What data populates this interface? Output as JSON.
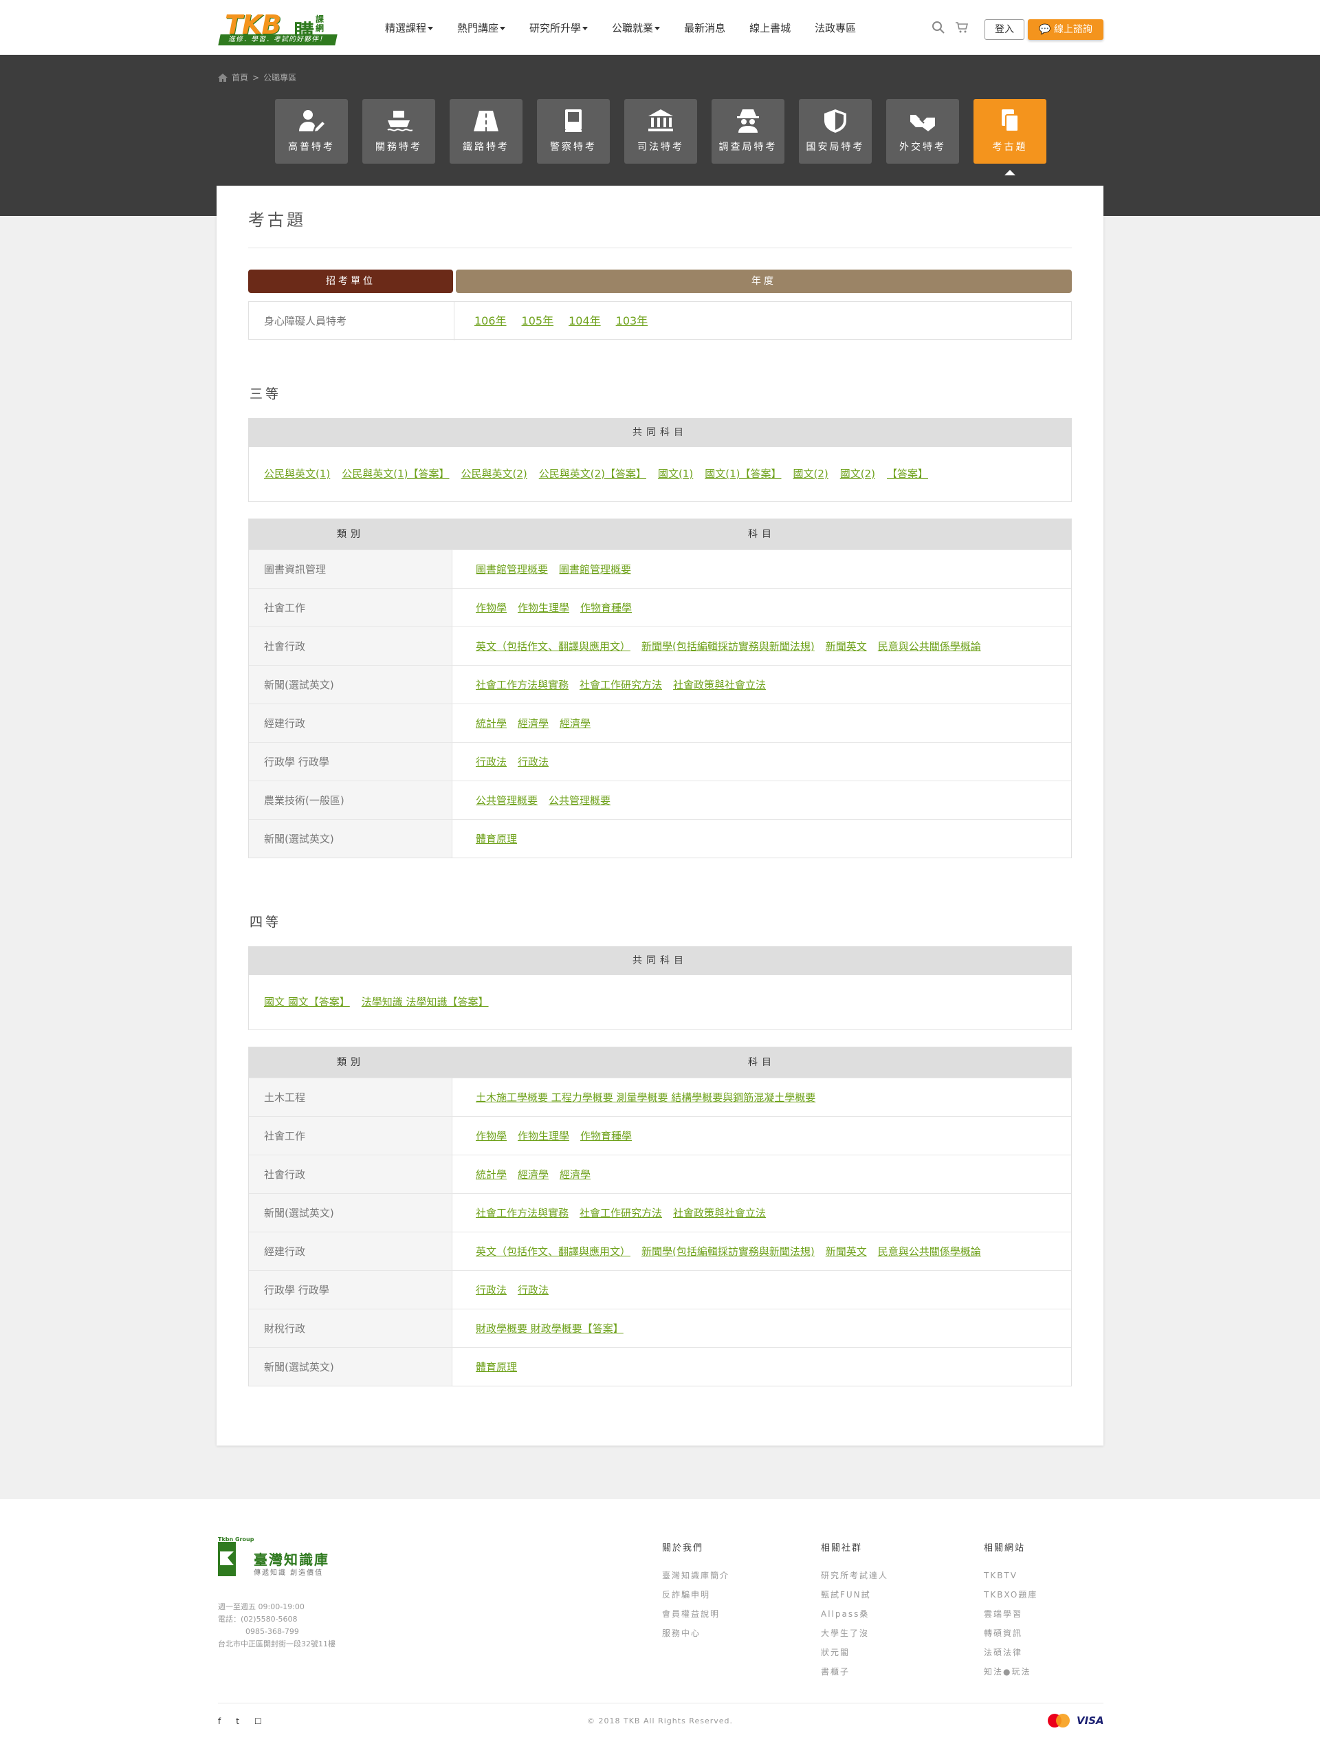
{
  "header": {
    "logo_text": "TKB",
    "logo_gou": "購",
    "logo_small": "課網",
    "logo_slogan": "進修．學習．考試的好夥伴！",
    "nav": [
      {
        "label": "精選課程",
        "dropdown": true
      },
      {
        "label": "熱門講座",
        "dropdown": true
      },
      {
        "label": "研究所升學",
        "dropdown": true
      },
      {
        "label": "公職就業",
        "dropdown": true
      },
      {
        "label": "最新消息",
        "dropdown": false
      },
      {
        "label": "線上書城",
        "dropdown": false
      },
      {
        "label": "法政專區",
        "dropdown": false
      }
    ],
    "login_label": "登入",
    "consult_label": "線上諮詢",
    "accent": "#f4941d"
  },
  "breadcrumb": {
    "home": "首頁",
    "sep": ">",
    "current": "公職專區"
  },
  "categories": [
    {
      "label": "高普特考",
      "icon": "user-edit-icon"
    },
    {
      "label": "關務特考",
      "icon": "ship-icon"
    },
    {
      "label": "鐵路特考",
      "icon": "road-icon"
    },
    {
      "label": "警察特考",
      "icon": "book-icon"
    },
    {
      "label": "司法特考",
      "icon": "courthouse-icon"
    },
    {
      "label": "調查局特考",
      "icon": "detective-icon"
    },
    {
      "label": "國安局特考",
      "icon": "shield-icon"
    },
    {
      "label": "外交特考",
      "icon": "handshake-icon"
    },
    {
      "label": "考古題",
      "icon": "copy-icon",
      "active": true
    }
  ],
  "main": {
    "title": "考古題",
    "unit_header": "招考單位",
    "year_header": "年度",
    "unit_header_color": "#6b2a18",
    "year_header_color": "#9b8466",
    "unit": "身心障礙人員特考",
    "years": [
      "106年",
      "105年",
      "104年",
      "103年"
    ]
  },
  "level3": {
    "title": "三等",
    "common_header": "共同科目",
    "common_links": [
      "公民與英文(1)",
      "公民與英文(1)【答案】",
      "公民與英文(2)",
      "公民與英文(2)【答案】",
      "國文(1)",
      "國文(1)【答案】",
      "國文(2)",
      "國文(2)",
      "【答案】"
    ],
    "col_category": "類別",
    "col_subject": "科目",
    "rows": [
      {
        "category": "圖書資訊管理",
        "subjects": [
          "圖書館管理概要",
          "圖書館管理概要"
        ]
      },
      {
        "category": "社會工作",
        "subjects": [
          "作物學",
          "作物生理學",
          "作物育種學"
        ]
      },
      {
        "category": "社會行政",
        "subjects": [
          "英文（包括作文、翻譯與應用文）",
          "新聞學(包括編輯採訪實務與新聞法規)",
          "新聞英文",
          "民意與公共關係學概論"
        ]
      },
      {
        "category": "新聞(選試英文)",
        "subjects": [
          "社會工作方法與實務",
          "社會工作研究方法",
          "社會政策與社會立法"
        ]
      },
      {
        "category": "經建行政",
        "subjects": [
          "統計學",
          "經濟學",
          "經濟學"
        ]
      },
      {
        "category": "行政學 行政學",
        "subjects": [
          "行政法",
          "行政法"
        ]
      },
      {
        "category": "農業技術(一般區)",
        "subjects": [
          "公共管理概要",
          "公共管理概要"
        ]
      },
      {
        "category": "新聞(選試英文)",
        "subjects": [
          "體育原理"
        ]
      }
    ]
  },
  "level4": {
    "title": "四等",
    "common_header": "共同科目",
    "common_links": [
      "國文 國文【答案】",
      "法學知識 法學知識【答案】"
    ],
    "col_category": "類別",
    "col_subject": "科目",
    "rows": [
      {
        "category": "土木工程",
        "subjects": [
          "土木施工學概要 工程力學概要 測量學概要 結構學概要與鋼筋混凝土學概要"
        ]
      },
      {
        "category": "社會工作",
        "subjects": [
          "作物學",
          "作物生理學",
          "作物育種學"
        ]
      },
      {
        "category": "社會行政",
        "subjects": [
          "統計學",
          "經濟學",
          "經濟學"
        ]
      },
      {
        "category": "新聞(選試英文)",
        "subjects": [
          "社會工作方法與實務",
          "社會工作研究方法",
          "社會政策與社會立法"
        ]
      },
      {
        "category": "經建行政",
        "subjects": [
          "英文（包括作文、翻譯與應用文）",
          "新聞學(包括編輯採訪實務與新聞法規)",
          "新聞英文",
          "民意與公共關係學概論"
        ]
      },
      {
        "category": "行政學 行政學",
        "subjects": [
          "行政法",
          "行政法"
        ]
      },
      {
        "category": "財稅行政",
        "subjects": [
          "財政學概要 財政學概要【答案】"
        ]
      },
      {
        "category": "新聞(選試英文)",
        "subjects": [
          "體育原理"
        ]
      }
    ]
  },
  "footer": {
    "brand_small": "Tkbn Group",
    "brand_name": "臺灣知識庫",
    "brand_slogan": "傳遞知識 創造價值",
    "hours": "週一至週五 09:00-19:00",
    "phone": "電話：(02)5580-5608",
    "phone2": "0985-368-799",
    "address": "台北市中正區開封街一段32號11樓",
    "columns": [
      {
        "title": "關於我們",
        "items": [
          "臺灣知識庫簡介",
          "反詐騙申明",
          "會員權益說明",
          "服務中心"
        ]
      },
      {
        "title": "相關社群",
        "items": [
          "研究所考試達人",
          "甄試FUN試",
          "Allpass桑",
          "大學生了沒",
          "狀元閣",
          "書櫃子"
        ]
      },
      {
        "title": "相關網站",
        "items": [
          "TKBTV",
          "TKBXO題庫",
          "雲端學習",
          "轉碩資訊",
          "法碩法律",
          "知法●玩法"
        ]
      }
    ],
    "social": [
      "f",
      "t",
      "☐"
    ],
    "copyright": "© 2018 TKB All Rights Reserved.",
    "pay_visa": "VISA"
  }
}
